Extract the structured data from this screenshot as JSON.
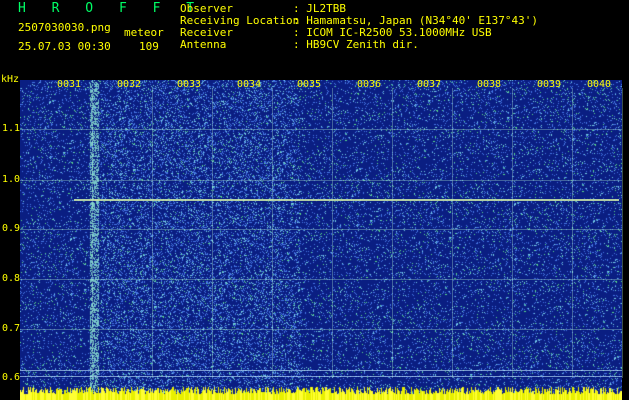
{
  "header": {
    "app_name": "H R O F F T",
    "filename": "2507030030.png",
    "datetime": "25.07.03 00:30",
    "meteor_label": "meteor",
    "meteor_count": "109"
  },
  "info": {
    "observer_key": "Observer",
    "observer_val": ": JL2TBB",
    "location_key": "Receiving Location",
    "location_val": ": Hamamatsu, Japan (N34°40' E137°43')",
    "receiver_key": "Receiver",
    "receiver_val": ": ICOM IC-R2500 53.1000MHz USB",
    "antenna_key": "Antenna",
    "antenna_val": ": HB9CV Zenith dir."
  },
  "axis": {
    "unit": "kHz",
    "y_ticks": [
      "1.1",
      "1.0",
      "0.9",
      "0.8",
      "0.7",
      "0.6"
    ],
    "x_ticks": [
      "0031",
      "0032",
      "0033",
      "0034",
      "0035",
      "0036",
      "0037",
      "0038",
      "0039",
      "0040"
    ]
  },
  "colors": {
    "background": "#000000",
    "text": "#ffff00",
    "title": "#00ff66",
    "spectrogram_base": "#1d3aa8"
  }
}
